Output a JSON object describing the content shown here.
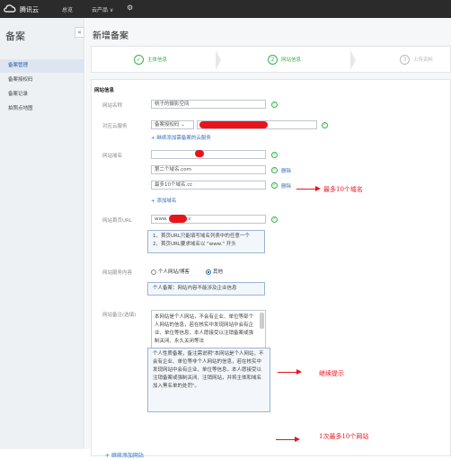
{
  "topbar": {
    "brand": "腾讯云",
    "nav": [
      "总览",
      "云产品"
    ],
    "nav_caret": "∨",
    "gear": "⚙"
  },
  "sidebar": {
    "title": "备案",
    "collapse": "«",
    "items": [
      {
        "label": "备案管理",
        "active": true
      },
      {
        "label": "备案授权码",
        "active": false
      },
      {
        "label": "备案记录",
        "active": false
      },
      {
        "label": "拍照点地图",
        "active": false
      }
    ]
  },
  "main": {
    "page_title": "新增备案",
    "steps": [
      {
        "mark": "✓",
        "label": "主体信息"
      },
      {
        "mark": "2",
        "label": "网站信息"
      },
      {
        "mark": "3",
        "label": "上传资料"
      }
    ],
    "section_title": "网站信息",
    "form": {
      "site_name_label": "网站名称",
      "site_name_value": "桃子的摄影空间",
      "cloud_service_label": "对应云服务",
      "cloud_service_select": "备案授权码",
      "add_cloud_link": "+ 继续添加需备案的云服务",
      "domain_label": "网站域名",
      "domain_2": "第二个域名.com",
      "domain_3": "最多10个域名.cc",
      "delete_label": "删除",
      "add_domain_link": "+ 添加域名",
      "homepage_label": "网站首页URL",
      "homepage_value": "www.",
      "homepage_value_tail": "cc",
      "homepage_tips": [
        "1、首页URL只能填写域名列表中的任意一个",
        "2、首页URL要求域名以 \"www.\" 开头"
      ],
      "service_label": "网站服务内容",
      "service_options": [
        "个人网站/博客",
        "其他"
      ],
      "service_tip": "个人备案：网站内容不能涉及企业信息",
      "remark_label": "网站备注(选填)",
      "remark_text": "本网站是个人网站，不会有企业、单位等部个人网站的信息，若在核实中发现网站中会有企业、单位等信息，本人愿接受以注销备案或强制关闭、永久关闭等法",
      "remark_tip": "个人性质备案，备注需说明\"本网站是个人网站，不会有企业、单位等非个人网站的信息，若在核实中发现网站中会有企业、单位等信息，本人愿接受以注销备案或强制关闭、注销网站，并将主体和域名加入黑名单的处罚\"。",
      "add_site_link": "+ 继续添加网站"
    }
  },
  "annotations": {
    "max_domains": "最多10个域名",
    "continue_tip": "继续提示",
    "max_sites": "1次最多10个网站",
    "color": "#e8141c"
  }
}
